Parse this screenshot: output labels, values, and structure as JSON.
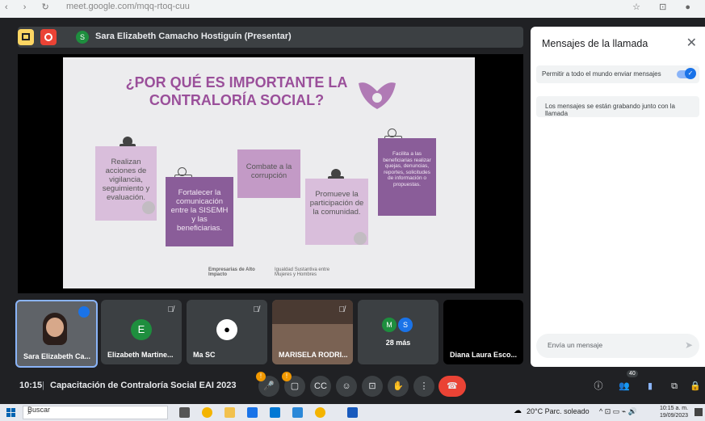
{
  "browser": {
    "url": "meet.google.com/mqq-rtoq-cuu"
  },
  "presenter": {
    "avatar_letter": "S",
    "label": "Sara Elizabeth Camacho Hostiguín (Presentar)"
  },
  "slide": {
    "title": "¿POR QUÉ ES IMPORTANTE LA CONTRALORÍA SOCIAL?",
    "notes": [
      "Realizan acciones de vigilancia, seguimiento y evaluación.",
      "Fortalecer la comunicación entre la SISEMH y las beneficiarias.",
      "Combate a la corrupción",
      "Promueve la participación de la comunidad.",
      "Facilita a las beneficiarias realizar quejas, denuncias, reportes, solicitudes de información o propuestas."
    ],
    "footer_left": "Empresarias de Alto Impacto",
    "footer_right": "Igualdad Sustantiva entre Mujeres y Hombres"
  },
  "participants": [
    {
      "name": "Sara Elizabeth Ca...",
      "avatar": "",
      "color": "#7a5c4a"
    },
    {
      "name": "Elizabeth Martine...",
      "avatar": "E",
      "color": "#1e8e3e"
    },
    {
      "name": "Ma SC",
      "avatar": "",
      "color": "#ffffff"
    },
    {
      "name": "MARISELA RODRI...",
      "avatar": "",
      "color": "#8a6d5a"
    },
    {
      "name": "28 más",
      "avatar": "M",
      "avatar2": "S",
      "color": "#1e8e3e"
    },
    {
      "name": "Diana Laura Esco...",
      "avatar": "",
      "color": "#000000"
    }
  ],
  "meeting_bar": {
    "time": "10:15",
    "separator": "|",
    "title": "Capacitación de Contraloría Social EAI 2023",
    "participants_count": "40",
    "mic_badge": "!",
    "cam_badge": "!"
  },
  "chat_panel": {
    "title": "Mensajes de la llamada",
    "allow_label": "Permitir a todo el mundo enviar mensajes",
    "recording_notice": "Los mensajes se están grabando junto con la llamada",
    "input_placeholder": "Envía un mensaje"
  },
  "taskbar": {
    "search_placeholder": "Buscar",
    "weather": "20°C  Parc. soleado",
    "time": "10:15 a. m.",
    "date": "19/09/2023"
  },
  "colors": {
    "accent": "#1a73e8",
    "danger": "#ea4335",
    "slide_purple": "#9a4f9a"
  }
}
